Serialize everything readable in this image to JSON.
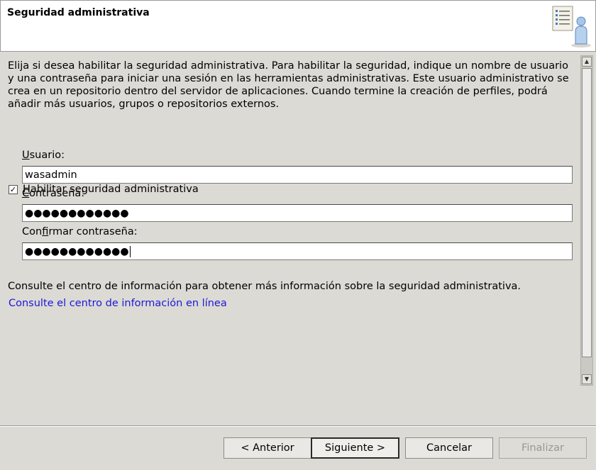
{
  "header": {
    "title": "Seguridad administrativa"
  },
  "intro": {
    "text": "Elija si desea habilitar la seguridad administrativa. Para habilitar la seguridad, indique un nombre de usuario y una contraseña para iniciar una sesión en las herramientas administrativas. Este usuario administrativo se crea en un repositorio dentro del servidor de aplicaciones. Cuando termine la creación de perfiles, podrá añadir más usuarios, grupos o repositorios externos."
  },
  "security": {
    "checkbox_mnemonic": "H",
    "checkbox_rest": "abilitar seguridad administrativa",
    "checked": true,
    "check_glyph": "✓"
  },
  "fields": {
    "user": {
      "label_mnemonic": "U",
      "label_rest": "suario:",
      "value": "wasadmin"
    },
    "password": {
      "label_mnemonic": "C",
      "label_rest": "ontraseña:",
      "value_masked": "●●●●●●●●●●●●"
    },
    "confirm": {
      "label_before": "Con",
      "label_mnemonic": "f",
      "label_after": "irmar contraseña:",
      "value_masked": "●●●●●●●●●●●●"
    }
  },
  "info": {
    "text": "Consulte el centro de información para obtener más información sobre la seguridad administrativa.",
    "link": "Consulte el centro de información en línea",
    "link_color": "#1a1ad6"
  },
  "scrollbar": {
    "up_glyph": "▲",
    "down_glyph": "▼"
  },
  "buttons": {
    "back": "< Anterior",
    "next": "Siguiente >",
    "cancel": "Cancelar",
    "finish": "Finalizar"
  },
  "icons": {
    "header_art": "checklist-user-icon"
  }
}
